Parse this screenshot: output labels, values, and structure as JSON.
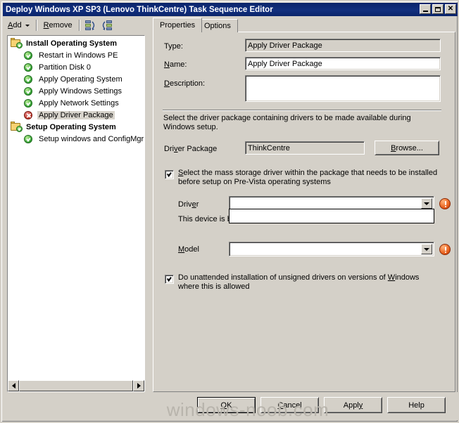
{
  "window": {
    "title": "Deploy Windows XP SP3 (Lenovo ThinkCentre) Task Sequence Editor",
    "minimize_label": "Minimize",
    "maximize_label": "Maximize",
    "close_label": "Close",
    "close_glyph": "✕",
    "titlebar_color": "#0a246a",
    "face_color": "#d4d0c8"
  },
  "toolbar": {
    "add_label": "Add",
    "add_accel": "A",
    "remove_label": "Remove",
    "remove_accel": "R",
    "icon1_name": "collapse-tree-icon",
    "icon2_name": "expand-tree-icon"
  },
  "tree": {
    "items": [
      {
        "label": "Install Operating System",
        "icon": "folder-check-icon",
        "level": 0,
        "selected": false
      },
      {
        "label": "Restart in Windows PE",
        "icon": "green-check-icon",
        "level": 1,
        "selected": false
      },
      {
        "label": "Partition Disk 0",
        "icon": "green-check-icon",
        "level": 1,
        "selected": false
      },
      {
        "label": "Apply Operating System",
        "icon": "green-check-icon",
        "level": 1,
        "selected": false
      },
      {
        "label": "Apply Windows Settings",
        "icon": "green-check-icon",
        "level": 1,
        "selected": false
      },
      {
        "label": "Apply Network Settings",
        "icon": "green-check-icon",
        "level": 1,
        "selected": false
      },
      {
        "label": "Apply Driver Package",
        "icon": "red-error-icon",
        "level": 1,
        "selected": true
      },
      {
        "label": "Setup Operating System",
        "icon": "folder-check-icon",
        "level": 0,
        "selected": false
      },
      {
        "label": "Setup windows and ConfigMgr",
        "icon": "green-check-icon",
        "level": 1,
        "selected": false
      }
    ],
    "hscroll_left_name": "scroll-left-arrow-icon",
    "hscroll_right_name": "scroll-right-arrow-icon"
  },
  "tabs": [
    {
      "label": "Properties",
      "active": true
    },
    {
      "label": "Options",
      "active": false
    }
  ],
  "form": {
    "type_label": "Type:",
    "type_value": "Apply Driver Package",
    "name_label": "Name:",
    "name_accel": "N",
    "name_value": "Apply Driver Package",
    "description_label": "Description:",
    "description_accel": "D",
    "description_value": "",
    "instruction_text": "Select the driver package containing drivers to be made available during Windows setup.",
    "driver_package_label": "Driver Package",
    "driver_package_accel": "v",
    "driver_package_value": "ThinkCentre",
    "browse_label": "Browse...",
    "browse_accel": "B",
    "mass_storage_checkbox_checked": true,
    "mass_storage_text_line1": "Select the mass storage driver within the package that needs to be installed",
    "mass_storage_text_line2": "before setup on Pre-Vista operating systems",
    "mass_storage_accel": "S",
    "driver_label": "Driver",
    "driver_accel": "e",
    "driver_value": "",
    "driver_error_icon": "error-exclamation-icon",
    "boot_critical_text": "This device is boot critical for Pre-Vista operating systems.",
    "model_label": "Model",
    "model_accel": "M",
    "model_value": "",
    "model_error_icon": "error-exclamation-icon",
    "unattended_checkbox_checked": true,
    "unattended_text_line1": "Do unattended installation of unsigned drivers on versions of Windows",
    "unattended_text_line2": "where this is allowed",
    "unattended_accel": "W"
  },
  "footer": {
    "ok_label": "OK",
    "ok_accel": "O",
    "cancel_label": "Cancel",
    "cancel_accel": "C",
    "apply_label": "Apply",
    "apply_accel": "y",
    "help_label": "Help"
  },
  "watermark": {
    "text": "windows-noob.com",
    "color": "#b8b4ac"
  }
}
